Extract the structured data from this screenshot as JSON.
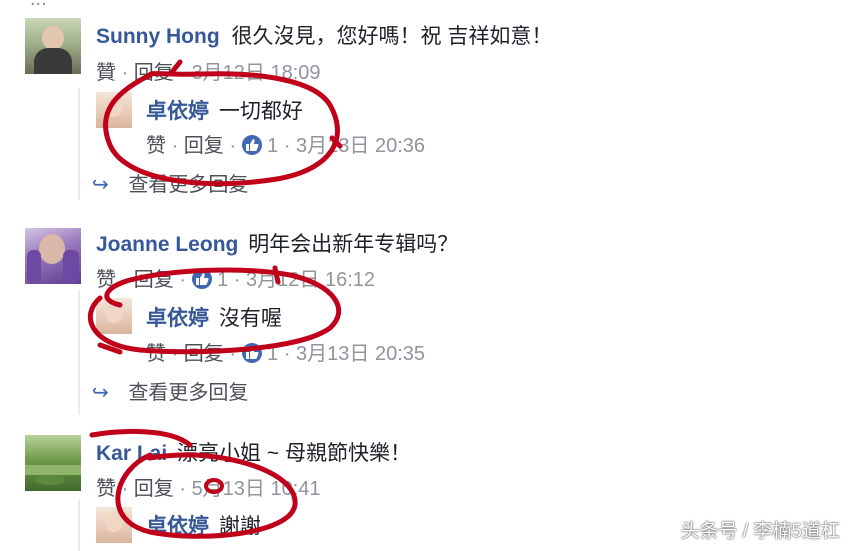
{
  "header_partial": "...",
  "comments": [
    {
      "name": "Sunny Hong",
      "text": "很久沒見，您好嗎！祝 吉祥如意！",
      "like_label": "贊",
      "reply_label": "回复",
      "time": "3月12日 18:09",
      "reply": {
        "name": "卓依婷",
        "text": "一切都好",
        "like_label": "赞",
        "reply_label": "回复",
        "reactions": "1",
        "time": "3月13日 20:36"
      },
      "more_replies": "查看更多回复"
    },
    {
      "name": "Joanne Leong",
      "text": "明年会出新年专辑吗？",
      "like_label": "赞",
      "reply_label": "回复",
      "reactions": "1",
      "time": "3月12日 16:12",
      "reply": {
        "name": "卓依婷",
        "text": "沒有喔",
        "like_label": "赞",
        "reply_label": "回复",
        "reactions": "1",
        "time": "3月13日 20:35"
      },
      "more_replies": "查看更多回复"
    },
    {
      "name": "Kar Lai",
      "text": "漂亮小姐 ~ 母親節快樂！",
      "like_label": "赞",
      "reply_label": "回复",
      "time": "5月13日 10:41",
      "reply": {
        "name": "卓依婷",
        "text": "謝謝"
      }
    }
  ],
  "watermark": "头条号 / 李楠5道杠",
  "colors": {
    "name_blue": "#365899",
    "meta_gray": "#90949c",
    "annotation_red": "#c0001a",
    "like_blue": "#4267b2"
  }
}
